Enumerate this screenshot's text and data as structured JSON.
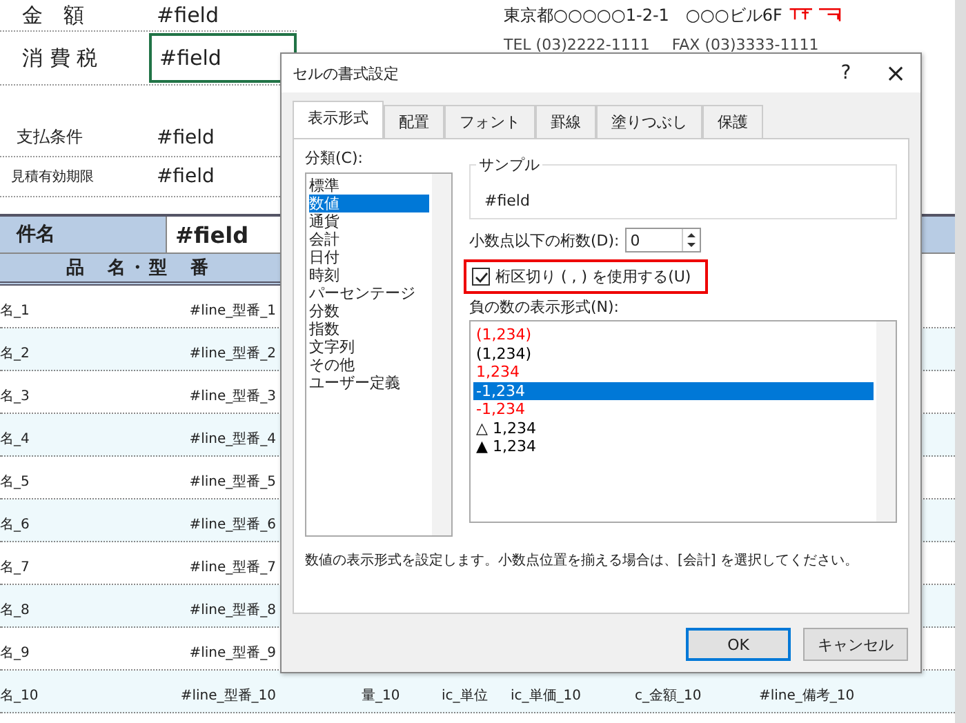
{
  "sheet": {
    "fields": [
      {
        "label": "金　額",
        "value": "#field",
        "selected": false
      },
      {
        "label": "消 費 税",
        "value": "#field",
        "selected": true
      },
      {
        "label": "支払条件",
        "value": "#field",
        "selected": false
      },
      {
        "label": "見積有効期限",
        "value": "#field",
        "selected": false
      }
    ],
    "address": "東京都○○○○○1-2-1　○○○ビル6F",
    "tel": "TEL (03)2222-1111",
    "fax": "FAX (03)3333-1111",
    "subject": {
      "label": "件名",
      "value": "#field"
    },
    "column_header": "品　名・型　番",
    "lines": [
      {
        "name": "名_1",
        "model": "#line_型番_1"
      },
      {
        "name": "名_2",
        "model": "#line_型番_2"
      },
      {
        "name": "名_3",
        "model": "#line_型番_3"
      },
      {
        "name": "名_4",
        "model": "#line_型番_4"
      },
      {
        "name": "名_5",
        "model": "#line_型番_5"
      },
      {
        "name": "名_6",
        "model": "#line_型番_6"
      },
      {
        "name": "名_7",
        "model": "#line_型番_7"
      },
      {
        "name": "名_8",
        "model": "#line_型番_8"
      },
      {
        "name": "名_9",
        "model": "#line_型番_9"
      },
      {
        "name": "名_10",
        "model": "#line_型番_10",
        "cells": [
          "量_10",
          "ic_単位",
          "ic_単価_10",
          "c_金額_10",
          "#line_備考_10"
        ]
      }
    ]
  },
  "dialog": {
    "title": "セルの書式設定",
    "help": "?",
    "close": "×",
    "tabs": [
      {
        "label": "表示形式",
        "selected": true
      },
      {
        "label": "配置",
        "selected": false
      },
      {
        "label": "フォント",
        "selected": false
      },
      {
        "label": "罫線",
        "selected": false
      },
      {
        "label": "塗りつぶし",
        "selected": false
      },
      {
        "label": "保護",
        "selected": false
      }
    ],
    "category_label": "分類(C):",
    "categories": [
      {
        "label": "標準",
        "selected": false
      },
      {
        "label": "数値",
        "selected": true
      },
      {
        "label": "通貨",
        "selected": false
      },
      {
        "label": "会計",
        "selected": false
      },
      {
        "label": "日付",
        "selected": false
      },
      {
        "label": "時刻",
        "selected": false
      },
      {
        "label": "パーセンテージ",
        "selected": false
      },
      {
        "label": "分数",
        "selected": false
      },
      {
        "label": "指数",
        "selected": false
      },
      {
        "label": "文字列",
        "selected": false
      },
      {
        "label": "その他",
        "selected": false
      },
      {
        "label": "ユーザー定義",
        "selected": false
      }
    ],
    "sample_label": "サンプル",
    "sample_value": "#field",
    "decimal_label": "小数点以下の桁数(D):",
    "decimal_value": "0",
    "separator": {
      "label": "桁区切り ( , ) を使用する(U)",
      "checked": true,
      "highlighted": true
    },
    "negative_label": "負の数の表示形式(N):",
    "negative_formats": [
      {
        "label": "(1,234)",
        "color": "#ff0000",
        "selected": false
      },
      {
        "label": "(1,234)",
        "color": "#000000",
        "selected": false
      },
      {
        "label": "1,234",
        "color": "#ff0000",
        "selected": false
      },
      {
        "label": "-1,234",
        "selected": true
      },
      {
        "label": "-1,234",
        "color": "#ff0000",
        "selected": false
      },
      {
        "label": "△ 1,234",
        "color": "#000000",
        "selected": false
      },
      {
        "label": "▲ 1,234",
        "color": "#000000",
        "selected": false
      }
    ],
    "description": "数値の表示形式を設定します。小数点位置を揃える場合は、[会計] を選択してください。",
    "buttons": [
      {
        "label": "OK",
        "default": true
      },
      {
        "label": "キャンセル",
        "default": false
      }
    ]
  }
}
